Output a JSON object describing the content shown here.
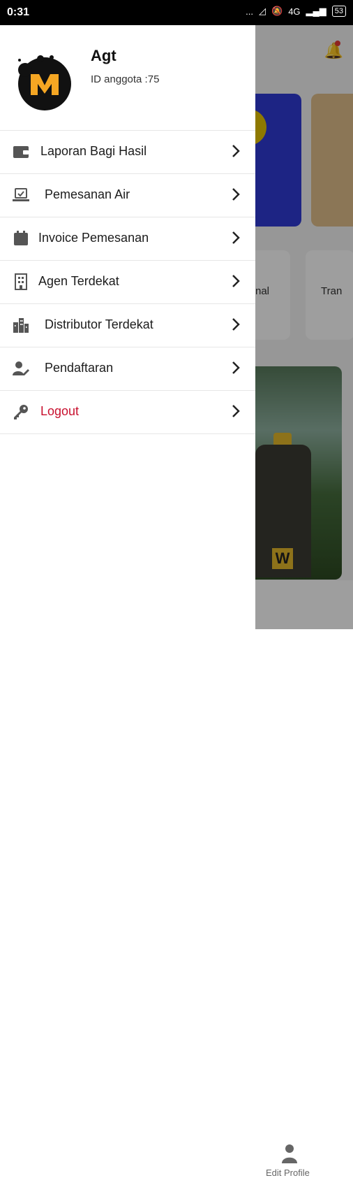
{
  "status_bar": {
    "time": "0:31",
    "indicators": [
      "...",
      "signal-off-icon",
      "mute-icon",
      "4G",
      "signal-icon"
    ],
    "battery": "53"
  },
  "background": {
    "tile_texts": [
      "nal",
      "Tran"
    ],
    "bottom_nav_label": "Edit Profile",
    "bottle_mark": "W"
  },
  "drawer": {
    "user": {
      "name": "Agt",
      "member_id": "ID anggota :75"
    },
    "menu": [
      {
        "label": "Laporan Bagi Hasil",
        "icon": "wallet-icon"
      },
      {
        "label": "Pemesanan Air",
        "icon": "laptop-check-icon"
      },
      {
        "label": "Invoice Pemesanan",
        "icon": "calendar-icon"
      },
      {
        "label": "Agen Terdekat",
        "icon": "building-icon"
      },
      {
        "label": "Distributor Terdekat",
        "icon": "city-icon"
      },
      {
        "label": "Pendaftaran",
        "icon": "user-edit-icon"
      },
      {
        "label": "Logout",
        "icon": "key-icon"
      }
    ],
    "colors": {
      "logout": "#c8102e",
      "logo_yellow": "#f5a623"
    }
  }
}
